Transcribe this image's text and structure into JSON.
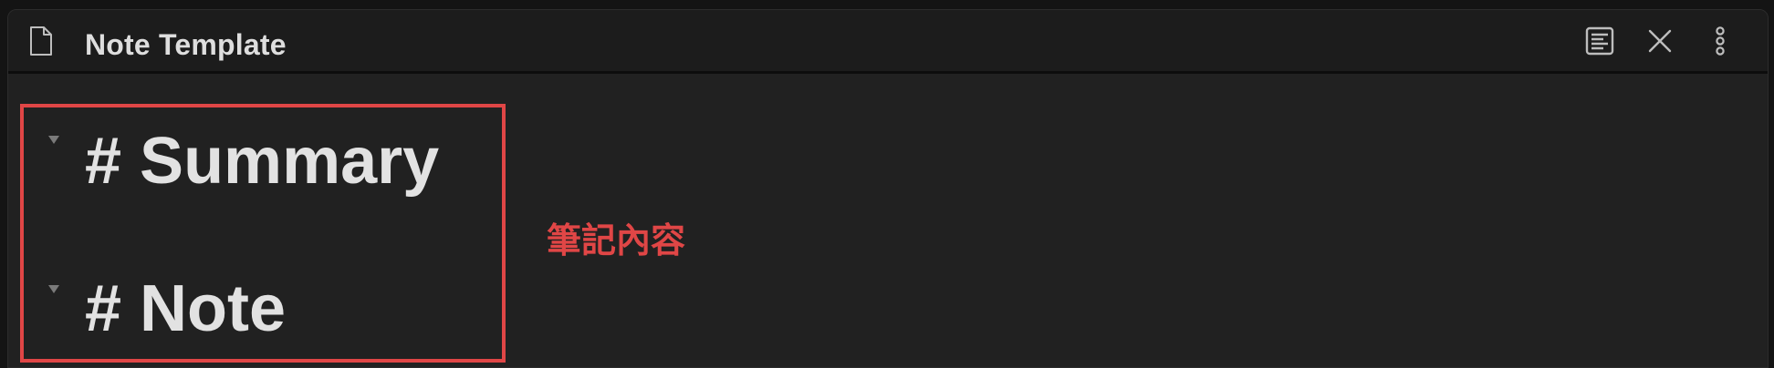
{
  "window": {
    "title": "Note Template"
  },
  "toolbar": {
    "icons": [
      "file-icon",
      "reading-view-icon",
      "close-icon",
      "more-options-icon"
    ]
  },
  "editor": {
    "headings": [
      "# Summary",
      "# Note"
    ]
  },
  "annotation": {
    "label": "筆記內容",
    "color": "#e04646"
  }
}
